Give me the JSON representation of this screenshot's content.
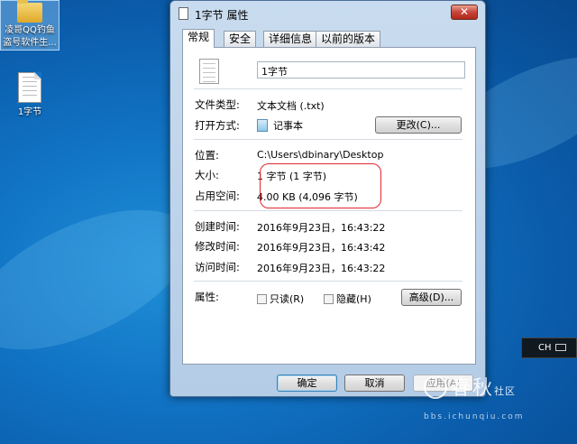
{
  "desktop": {
    "icons": [
      {
        "label_line1": "凌哥QQ钓鱼",
        "label_line2": "盗号软件生...",
        "type": "folder"
      },
      {
        "label_line1": "1字节",
        "label_line2": "",
        "type": "text-document"
      }
    ],
    "language_bar": {
      "label": "CH"
    },
    "watermark": {
      "brand": "春秋",
      "sub_top": "社",
      "sub_bottom": "区",
      "url": "bbs.ichunqiu.com"
    }
  },
  "window": {
    "title": "1字节 属性",
    "close_label": "✕",
    "tabs": [
      "常规",
      "安全",
      "详细信息",
      "以前的版本"
    ],
    "active_tab": "常规",
    "filename": "1字节",
    "file_type_label": "文件类型:",
    "file_type_value": "文本文档 (.txt)",
    "opens_with_label": "打开方式:",
    "opens_with_value": "记事本",
    "change_button": "更改(C)...",
    "location_label": "位置:",
    "location_value": "C:\\Users\\dbinary\\Desktop",
    "size_label": "大小:",
    "size_value": "1 字节 (1 字节)",
    "size_on_disk_label": "占用空间:",
    "size_on_disk_value": "4.00 KB (4,096 字节)",
    "created_label": "创建时间:",
    "created_value": "2016年9月23日，16:43:22",
    "modified_label": "修改时间:",
    "modified_value": "2016年9月23日，16:43:42",
    "accessed_label": "访问时间:",
    "accessed_value": "2016年9月23日，16:43:22",
    "attributes_label": "属性:",
    "readonly_label": "只读(R)",
    "hidden_label": "隐藏(H)",
    "advanced_button": "高级(D)...",
    "ok_button": "确定",
    "cancel_button": "取消",
    "apply_button": "应用(A)"
  },
  "colors": {
    "annotation": "#e0282e",
    "desktop_blue": "#1173c4"
  }
}
